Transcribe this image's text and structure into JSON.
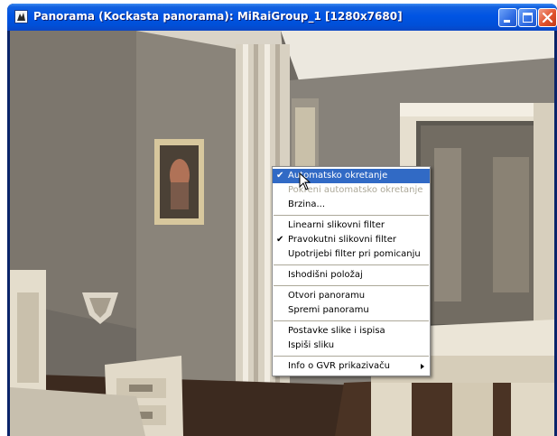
{
  "window": {
    "title": "Panorama (Kockasta panorama): MiRaiGroup_1 [1280x7680]"
  },
  "menu": {
    "items": [
      {
        "label": "Automatsko okretanje",
        "checked": true,
        "state": "highlighted"
      },
      {
        "label": "Pokreni automatsko okretanje",
        "checked": false,
        "state": "disabled"
      },
      {
        "label": "Brzina...",
        "checked": false,
        "state": "normal"
      },
      {
        "separator": true
      },
      {
        "label": "Linearni slikovni filter",
        "checked": false,
        "state": "normal"
      },
      {
        "label": "Pravokutni slikovni filter",
        "checked": true,
        "state": "normal"
      },
      {
        "label": "Upotrijebi filter pri pomicanju",
        "checked": false,
        "state": "normal"
      },
      {
        "separator": true
      },
      {
        "label": "Ishodišni položaj",
        "checked": false,
        "state": "normal"
      },
      {
        "separator": true
      },
      {
        "label": "Otvori panoramu",
        "checked": false,
        "state": "normal"
      },
      {
        "label": "Spremi panoramu",
        "checked": false,
        "state": "normal"
      },
      {
        "separator": true
      },
      {
        "label": "Postavke slike i ispisa",
        "checked": false,
        "state": "normal"
      },
      {
        "label": "Ispiši sliku",
        "checked": false,
        "state": "normal"
      },
      {
        "separator": true
      },
      {
        "label": "Info o GVR prikazivaču",
        "checked": false,
        "state": "normal",
        "submenu": true
      }
    ]
  },
  "icons": {
    "app": "panorama-app-icon",
    "minimize": "minimize-icon",
    "maximize": "maximize-icon",
    "close": "close-icon",
    "check": "checkmark-icon",
    "submenu": "submenu-arrow-icon",
    "cursor": "mouse-pointer-icon"
  },
  "colors": {
    "title_bar": "#0054e3",
    "menu_highlight": "#316ac5",
    "menu_disabled_text": "#aca899",
    "close_button": "#e0522c"
  }
}
